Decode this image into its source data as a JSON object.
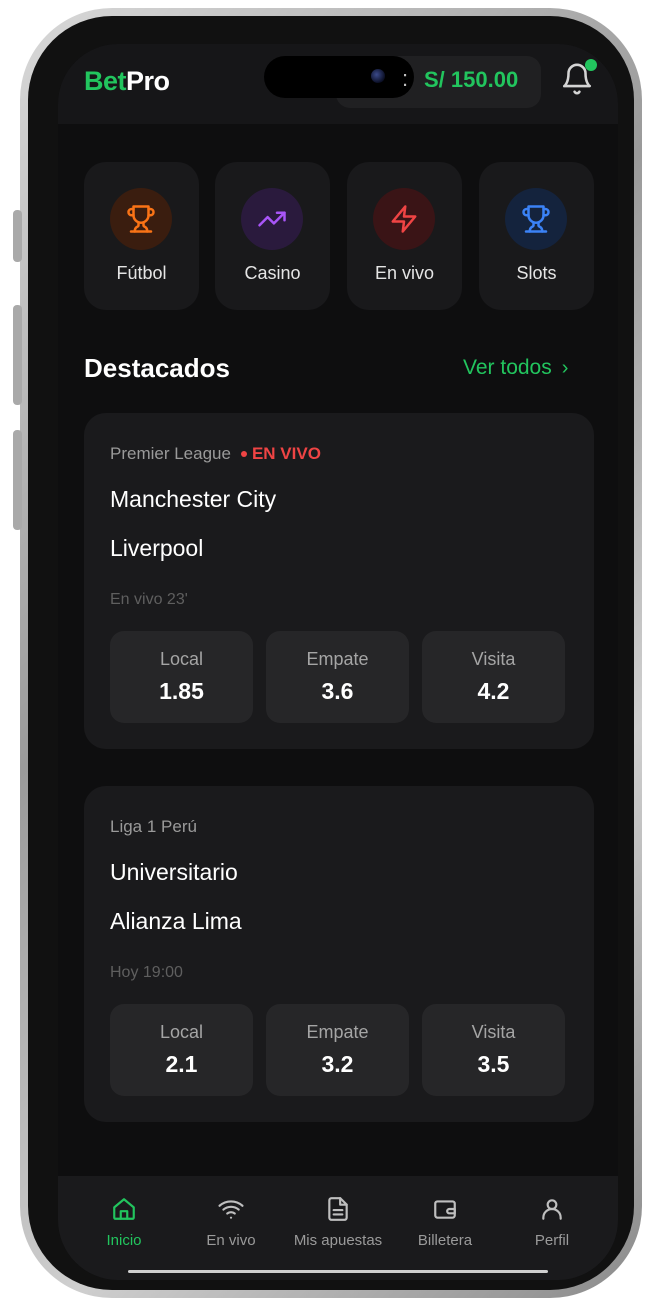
{
  "header": {
    "logo_primary": "Bet",
    "logo_secondary": "Pro",
    "balance_separator": ":",
    "balance": "S/ 150.00",
    "notification_badge_color": "#22c55e"
  },
  "categories": [
    {
      "label": "Fútbol",
      "icon": "trophy-icon",
      "color": "#f97316"
    },
    {
      "label": "Casino",
      "icon": "trending-up-icon",
      "color": "#a855f7"
    },
    {
      "label": "En vivo",
      "icon": "lightning-icon",
      "color": "#ef4444"
    },
    {
      "label": "Slots",
      "icon": "trophy-icon",
      "color": "#3b82f6"
    }
  ],
  "featured": {
    "title": "Destacados",
    "see_all": "Ver todos",
    "matches": [
      {
        "league": "Premier League",
        "live_badge": "EN VIVO",
        "home": "Manchester City",
        "away": "Liverpool",
        "time": "En vivo 23'",
        "odds": [
          {
            "label": "Local",
            "value": "1.85"
          },
          {
            "label": "Empate",
            "value": "3.6"
          },
          {
            "label": "Visita",
            "value": "4.2"
          }
        ]
      },
      {
        "league": "Liga 1 Perú",
        "home": "Universitario",
        "away": "Alianza Lima",
        "time": "Hoy 19:00",
        "odds": [
          {
            "label": "Local",
            "value": "2.1"
          },
          {
            "label": "Empate",
            "value": "3.2"
          },
          {
            "label": "Visita",
            "value": "3.5"
          }
        ]
      }
    ]
  },
  "bottom_nav": [
    {
      "label": "Inicio",
      "icon": "home-icon",
      "active": true
    },
    {
      "label": "En vivo",
      "icon": "wifi-icon",
      "active": false
    },
    {
      "label": "Mis apuestas",
      "icon": "document-icon",
      "active": false
    },
    {
      "label": "Billetera",
      "icon": "wallet-icon",
      "active": false
    },
    {
      "label": "Perfil",
      "icon": "user-icon",
      "active": false
    }
  ],
  "colors": {
    "accent": "#22c55e",
    "live": "#ef4444",
    "background": "#0e0e0f",
    "card": "#1a1a1c"
  }
}
